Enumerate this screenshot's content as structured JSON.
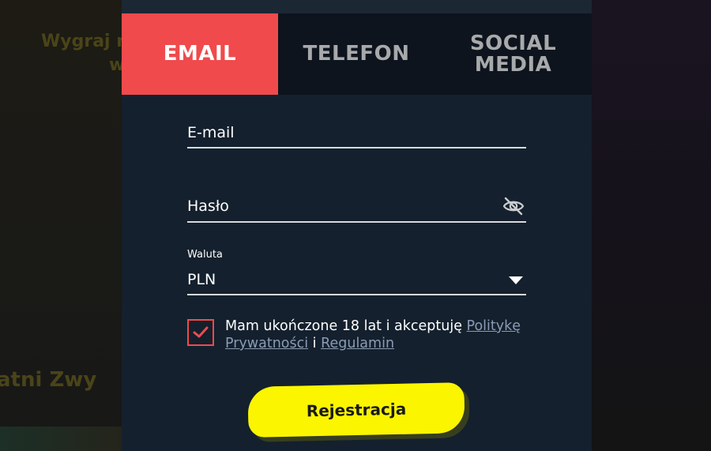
{
  "background": {
    "promo_line1": "Wygraj n",
    "promo_line2": "w",
    "winners_heading": "atni Zwy"
  },
  "tabs": [
    {
      "label": "EMAIL",
      "active": true
    },
    {
      "label": "TELEFON",
      "active": false
    },
    {
      "label": "SOCIAL\nMEDIA",
      "active": false
    }
  ],
  "form": {
    "email_placeholder": "E-mail",
    "password_placeholder": "Hasło",
    "password_toggle_icon": "eye-slash-icon",
    "currency_label": "Waluta",
    "currency_value": "PLN",
    "consent_checked": true,
    "consent_text": "Mam ukończone 18 lat i akceptuję ",
    "privacy_link": "Politykę Prywatności",
    "consent_and": " i ",
    "terms_link": "Regulamin",
    "submit_label": "Rejestracja"
  },
  "colors": {
    "accent_red": "#f04a4c",
    "button_yellow": "#fbf500",
    "modal_bg": "#14202d",
    "link": "#8b9bb5"
  }
}
